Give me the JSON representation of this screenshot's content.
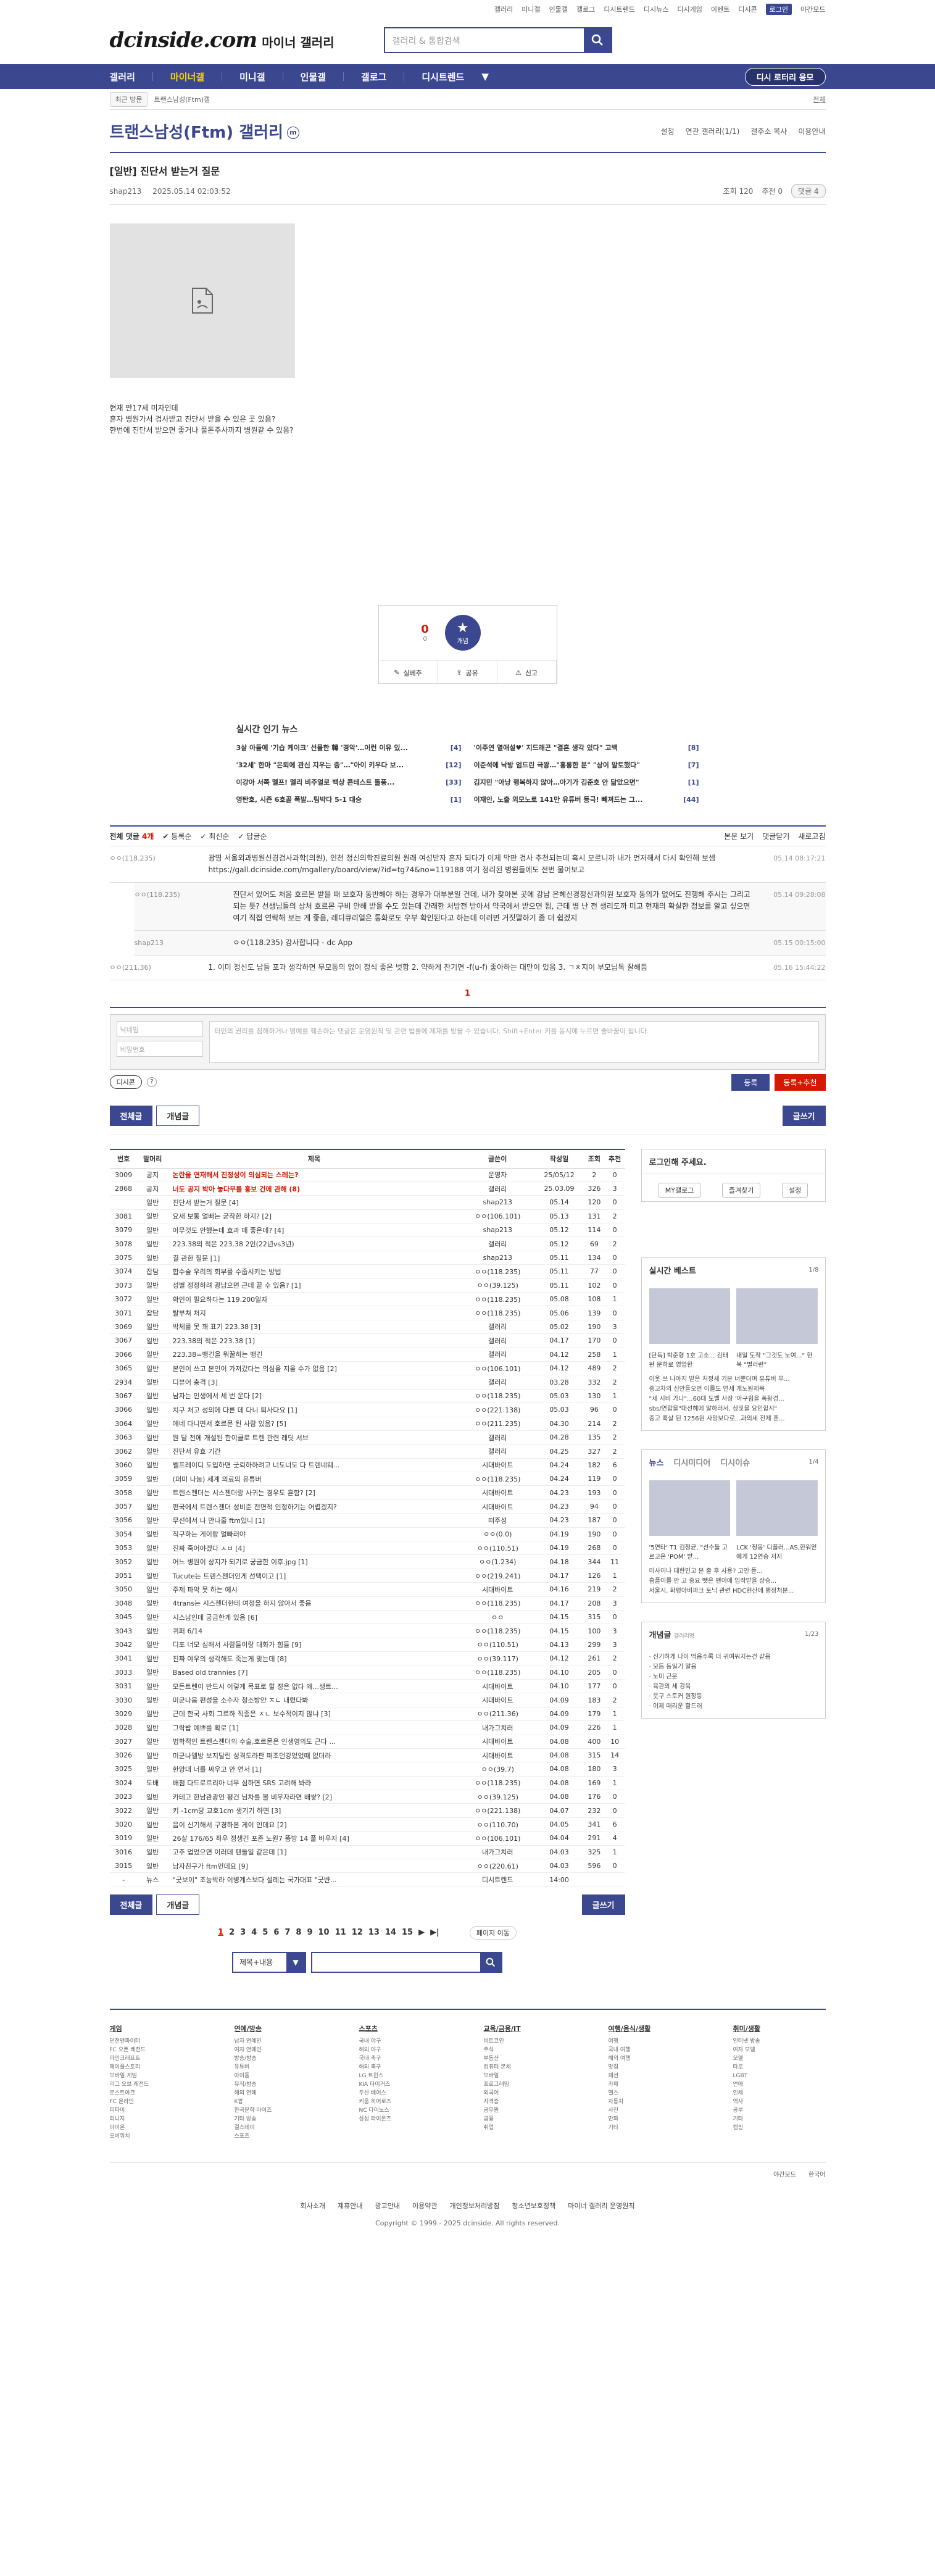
{
  "util": [
    "갤러리",
    "미니갤",
    "인물갤",
    "갤로그",
    "디시트렌드",
    "디시뉴스",
    "디시게임",
    "이벤트",
    "디시콘",
    "로그인",
    "야간모드"
  ],
  "header": {
    "brand": "dcinside.com",
    "sub": "마이너 갤러리",
    "search_placeholder": "갤러리 & 통합검색"
  },
  "gnb": {
    "items": [
      "갤러리",
      "마이너갤",
      "미니갤",
      "인물갤",
      "갤로그",
      "디시트렌드"
    ],
    "button": "디시 로터리 응모"
  },
  "subnav": {
    "recent": "최근 방문",
    "chip": "트랜스남성(Ftm)갤",
    "home": "전체"
  },
  "gallery": {
    "title": "트랜스남성(Ftm) 갤러리",
    "mini": "m",
    "tools": [
      "설정",
      "연관 갤러리(1/1)",
      "갤주소 복사",
      "이용안내"
    ]
  },
  "post": {
    "title": "[일반] 진단서 받는거 질문",
    "author": "shap213",
    "date": "2025.05.14 02:03:52",
    "views": "조회 120",
    "rec": "추천 0",
    "cmt": "댓글 4",
    "body": [
      "현재 만17세 미자인데",
      "혼자 병원가서 검사받고 진단서 받을 수 있은 곳 있음?",
      "한번에 진단서 받으면 좋거나 풀돈주사까지 병원같 수 있음?"
    ]
  },
  "rec": {
    "up": "0",
    "fixed": "0",
    "star_label": "개념",
    "actions": [
      "실베추",
      "공유",
      "신고"
    ]
  },
  "news": {
    "title": "실시간 인기 뉴스",
    "items": [
      {
        "t": "3살 아들에 '기습 케이크' 선물한 韓 '경악'…이런 이유 있...",
        "c": "4"
      },
      {
        "t": "'이주연 열애설♥' 지드래곤 \"결혼 생각 있다\" 고백",
        "c": "8"
      },
      {
        "t": "'32세' 한마 \"은퇴에 관신 지우는 중\"…\"아이 키우다 보...",
        "c": "12"
      },
      {
        "t": "이준석에 낙방 엄드린 극왕…\"홍롱한 분\" \"상이 말토했다\"",
        "c": "7"
      },
      {
        "t": "이강아 서쪽 멜프! 멜리 비주얼로 백상 콘테스트 돌풍...",
        "c": "33"
      },
      {
        "t": "김지민 \"아낭 행복하지 않아…아기가 김준호 안 닮았으면\"",
        "c": "1"
      },
      {
        "t": "영탄호, 시즌 6호골 폭발…팀박다 5-1 대승",
        "c": "1"
      },
      {
        "t": "이재인, 노출 외모노로 141만 유튜버 등극! 빼져드는 그...",
        "c": "44"
      }
    ]
  },
  "comments": {
    "label": "전체 댓글",
    "count": "4개",
    "sort": [
      "등록순",
      "최신순",
      "답글순"
    ],
    "tools": [
      "본문 보기",
      "댓글닫기",
      "새로고침"
    ],
    "items": [
      {
        "who": "ㅇㅇ(118.235)",
        "txt": "광명 서울외과병원신경검사과학(의원), 인천 정신의학진료의원 원래 여성받자 혼자 되다가 이제 막판 검사 추천되는데 혹시 모르니까 내가 먼저해서 다시 확인해 보셈 https://gall.dcinside.com/mgallery/board/view/?id=tg74&no=119188 여기 정리된 병원들에도 전번 물어보고",
        "dt": "05.14 08:17:21"
      },
      {
        "who": "ㅇㅇ(118.235)",
        "txt": "진단서 있어도 처음 호르몬 받을 때 보호자 동반해야 하는 경우가 대부분일 건데, 내가 찾아본 곳에 강남 은혜신경정신과의원 보호자 동의가 없어도 진행해 주시는 그리고 되는 듯? 선생님들의 상처 호르몬 구비 안해 받을 수도 있는데 간래한 처방전 받아서 약국에서 받으면 됨, 근데 병 난 전 생리도까 미고 현재의 확실한 정보를 알고 싶으면 여기 직접 연락해 보는 게 좋음, 레디큐리얼은 통화로도 우부 확인된다고 하는데 이러면 거짓말하기 좀 더 쉽겠지",
        "dt": "05.14 09:28:08"
      },
      {
        "who": "shap213",
        "txt": "ㅇㅇ(118.235) 강사합니다 - dc App",
        "dt": "05.15 00:15:00"
      },
      {
        "who": "ㅇㅇ(211.36)",
        "txt": "1. 이미 정신도 남들 포과 생각하면 무모동의 없이 정식 좋은 벗함 2. 약하게 찬기면 -f(u-f) 좋아하는 대만이 있음 3. ㄱㅊ지이 부모님독 잘해둠",
        "dt": "05.16 15:44:22"
      }
    ],
    "page": "1"
  },
  "write": {
    "name_ph": "닉네임",
    "pw_ph": "비밀번호",
    "area_ph": "타인의 권리를 침해하거나 명예를 훼손하는 댓글은 운영원칙 및 관련 법률에 제재를 받을 수 있습니다. Shift+Enter 키를 동시에 누르면 줄바꿈이 됩니다.",
    "dccon": "디시콘",
    "reg": "등록",
    "reg2": "등록+추천"
  },
  "listbtns": {
    "all": "전체글",
    "best": "개념글",
    "write": "글쓰기"
  },
  "list": {
    "headers": [
      "번호",
      "말머리",
      "제목",
      "글쓴이",
      "작성일",
      "조회",
      "추천"
    ],
    "rows": [
      [
        "3009",
        "공지",
        "논란을 연재해서 진정성이 의심되는 스레는?",
        "운영자",
        "25/05/12",
        "2",
        "0"
      ],
      [
        "2868",
        "공지",
        "너도 공지 박아 놓다무를 홍보 건에 관해 (8)",
        "갤러리",
        "25.03.09",
        "326",
        "3"
      ],
      [
        "",
        "일반",
        "진단서 받는거 질문 [4]",
        "shap213",
        "05.14",
        "120",
        "0"
      ],
      [
        "3081",
        "일반",
        "요새 보통 얼빠는 굳작한 하지? [2]",
        "ㅇㅇ(106.101)",
        "05.13",
        "131",
        "2"
      ],
      [
        "3079",
        "일반",
        "아무것도 안했는데 효과 매 좋은데? [4]",
        "shap213",
        "05.12",
        "114",
        "0"
      ],
      [
        "3078",
        "일반",
        "223.38의 적은 223.38 2인(22년vs3년)",
        "갤러리",
        "05.12",
        "69",
        "2"
      ],
      [
        "3075",
        "일반",
        "결 관한 질문 [1]",
        "shap213",
        "05.11",
        "134",
        "0"
      ],
      [
        "3074",
        "잡담",
        "합수술 우리의 회부를 수줍시키는 방법",
        "ㅇㅇ(118.235)",
        "05.11",
        "77",
        "0"
      ],
      [
        "3073",
        "일반",
        "성별 정정하려 광남으면 근데 끝 수 있음? [1]",
        "ㅇㅇ(39.125)",
        "05.11",
        "102",
        "0"
      ],
      [
        "3072",
        "일반",
        "확인이 필요하다는 119.200일자",
        "ㅇㅇ(118.235)",
        "05.08",
        "108",
        "1"
      ],
      [
        "3071",
        "잡담",
        "탈부쳐 처지",
        "ㅇㅇ(118.235)",
        "05.06",
        "139",
        "0"
      ],
      [
        "3069",
        "일반",
        "박체를 못 꽤 표기 223.38 [3]",
        "갤러리",
        "05.02",
        "190",
        "3"
      ],
      [
        "3067",
        "일반",
        "223.38의 적은 223.38 [1]",
        "갤러리",
        "04.17",
        "170",
        "0"
      ],
      [
        "3066",
        "일반",
        "223.38=뱅긴을 뭐꿀하는 뱅긴",
        "갤러리",
        "04.12",
        "258",
        "1"
      ],
      [
        "3065",
        "일반",
        "본인이 쓰고 본인이 가져갔다는 의심을 지울 수가 없음 [2]",
        "ㅇㅇ(106.101)",
        "04.12",
        "489",
        "2"
      ],
      [
        "2934",
        "일반",
        "디뷰어 충격 [3]",
        "갤러리",
        "03.28",
        "332",
        "2"
      ],
      [
        "3067",
        "일반",
        "남자는 인생에서 세 번 운다 [2]",
        "ㅇㅇ(118.235)",
        "05.03",
        "130",
        "1"
      ],
      [
        "3066",
        "일반",
        "치구 처고 성의에 다른 데 다니 퇴사다요 [1]",
        "ㅇㅇ(221.138)",
        "05.03",
        "96",
        "0"
      ],
      [
        "3064",
        "일반",
        "얘네 다니면서 호르몬 된 사람 있음? [5]",
        "ㅇㅇ(211.235)",
        "04.30",
        "214",
        "2"
      ],
      [
        "3063",
        "일반",
        "뭔 달 전에 개설된 한이클로 트렌 관련 레딧 서브",
        "갤러리",
        "04.28",
        "135",
        "2"
      ],
      [
        "3062",
        "일반",
        "진단서 유효 기간",
        "갤러리",
        "04.25",
        "327",
        "2"
      ],
      [
        "3060",
        "일반",
        "벨프레이디 도입하면 굿뢰하하려고 너도너도 다 트렌네웨...",
        "시대바이트",
        "04.24",
        "182",
        "6"
      ],
      [
        "3059",
        "일반",
        "(퍼미 나눔) 세계 의료의 유튜버",
        "ㅇㅇ(118.235)",
        "04.24",
        "119",
        "0"
      ],
      [
        "3058",
        "일반",
        "트렌스젠더는 시스젠더랑 사귀는 경우도 흔함? [2]",
        "시대바이트",
        "04.23",
        "193",
        "0"
      ],
      [
        "3057",
        "일반",
        "편국에서 트렌스젠더 성비준 전면적 인정하기는 어렵겠지?",
        "시대바이트",
        "04.23",
        "94",
        "0"
      ],
      [
        "3056",
        "일반",
        "무선에서 나 만나줄 ftm있니 [1]",
        "떠주성",
        "04.23",
        "187",
        "0"
      ],
      [
        "3054",
        "일반",
        "직구하는 게이랑 얼빠러야",
        "ㅇㅇ(0.0)",
        "04.19",
        "190",
        "0"
      ],
      [
        "3053",
        "일반",
        "진짜 죽어야겠다 ㅅㅂ [4]",
        "ㅇㅇ(110.51)",
        "04.19",
        "268",
        "0"
      ],
      [
        "3052",
        "일반",
        "어느 병원이 상지가 되기로 궁금한 이후.jpg [1]",
        "ㅇㅇ(1.234)",
        "04.18",
        "344",
        "11"
      ],
      [
        "3051",
        "일반",
        "Tucute는 트렌스젠더인게 선택이고 [1]",
        "ㅇㅇ(219.241)",
        "04.17",
        "126",
        "1"
      ],
      [
        "3050",
        "일반",
        "주제 파악 못 하는 에시",
        "시대바이트",
        "04.16",
        "219",
        "2"
      ],
      [
        "3048",
        "일반",
        "4trans는 시스젠더한테 여정을 하지 않아서 좋음",
        "ㅇㅇ(118.235)",
        "04.17",
        "208",
        "3"
      ],
      [
        "3045",
        "일반",
        "시스남인데 궁금한게 있음 [6]",
        "ㅇㅇ",
        "04.15",
        "315",
        "0"
      ],
      [
        "3043",
        "일반",
        "퀴퍼 6/14",
        "ㅇㅇ(118.235)",
        "04.15",
        "100",
        "3"
      ],
      [
        "3042",
        "일반",
        "디포 너모 심해서 사람들이랑 대화가 힘들 [9]",
        "ㅇㅇ(110.51)",
        "04.13",
        "299",
        "3"
      ],
      [
        "3041",
        "일반",
        "진짜 야우의 생각해도 죽는게 맞는데 [8]",
        "ㅇㅇ(39.117)",
        "04.12",
        "261",
        "2"
      ],
      [
        "3033",
        "일반",
        "Based old trannies [7]",
        "ㅇㅇ(118.235)",
        "04.10",
        "205",
        "0"
      ],
      [
        "3031",
        "일반",
        "모든트렌이 반드시 이렇게 목표로 할 정은 없다 왜...생트...",
        "시대바이트",
        "04.10",
        "177",
        "0"
      ],
      [
        "3030",
        "일반",
        "미군나음 편성을 소수자 청소방얀 ㅈㄴ 내렸다봐",
        "시대바이트",
        "04.09",
        "183",
        "2"
      ],
      [
        "3029",
        "일반",
        "근데 한국 사회 그르하 직종은 ㅈㄴ 보수적이지 않냐 [3]",
        "ㅇㅇ(211.36)",
        "04.09",
        "179",
        "1"
      ],
      [
        "3028",
        "일반",
        "그락밥 예쁘를 확로 [1]",
        "내가그치러",
        "04.09",
        "226",
        "1"
      ],
      [
        "3027",
        "일반",
        "법학적인 트렌스젠더의 수술,호르몬은 인생영의도 근다 ...",
        "시대바이트",
        "04.08",
        "400",
        "10"
      ],
      [
        "3026",
        "일반",
        "미군나엘방 보지달린 성격도라판 떠조던강었었때 없더라",
        "시대바이트",
        "04.08",
        "315",
        "14"
      ],
      [
        "3025",
        "일반",
        "한양대 너를 싸우고 안 연서 [1]",
        "ㅇㅇ(39.7)",
        "04.08",
        "180",
        "3"
      ],
      [
        "3024",
        "도배",
        "배첨 다드로르리아 너무 심하면 SRS 고려해 봐라",
        "ㅇㅇ(118.235)",
        "04.08",
        "169",
        "1"
      ],
      [
        "3023",
        "일반",
        "카테고 한남관광언 평건 님차를 볼 비우자라면 배쌓? [2]",
        "ㅇㅇ(39.125)",
        "04.08",
        "176",
        "0"
      ],
      [
        "3022",
        "일반",
        "키 -1cm당 교호1cm 생기기 하면 [3]",
        "ㅇㅇ(221.138)",
        "04.07",
        "232",
        "0"
      ],
      [
        "3020",
        "일반",
        "음이 신기해서 구경하본 게이 인데요 [2]",
        "ㅇㅇ(110.70)",
        "04.05",
        "341",
        "6"
      ],
      [
        "3019",
        "일반",
        "26살 176/65 좌우 정생긴 포존 노원7 똥방 14 풀 바우자 [4]",
        "ㅇㅇ(106.101)",
        "04.04",
        "291",
        "4"
      ],
      [
        "3016",
        "일반",
        "고추 업었으면 이러데 팬들일 같은데 [1]",
        "내가그치러",
        "04.03",
        "325",
        "1"
      ],
      [
        "3015",
        "일반",
        "남자친구가 ftm인데요 [9]",
        "ㅇㅇ(220.61)",
        "04.03",
        "596",
        "0"
      ],
      [
        "-",
        "뉴스",
        "\"굿보이\" 조능박라 이병계스보다 설레는 국가대표 \"굿뱐...",
        "디시트렌드",
        "14:00",
        "",
        ""
      ]
    ]
  },
  "side": {
    "login": "로그인해 주세요.",
    "login_btns": [
      "MY갤로그",
      "즐겨찾기",
      "설정"
    ],
    "best_title": "실시간 베스트",
    "best_page": "1/8",
    "best_caps": [
      "[단독] 박준형 1호 고소... 김태완 문하로 영업한",
      "내일 도착 \"그것도 노여...\" 한복 \"별러런\""
    ],
    "best_list": [
      "이웃 쓰 나아지 받은 처정세 기본 너뿐더며 유튜버 무...",
      "중고차의 신안들오먼 이를도 연세 개노원제목",
      "\"세 시비 가나\"...60대 도벨 사장 '아구힘을 폭황경...",
      "sbs/연합을\"대선혜에 알하러서, 상및을 요인합시\"",
      "중고 혹살 된 1256원 사망보다로...과의세 전제 훈..."
    ],
    "tabs": [
      "뉴스",
      "디시미디어",
      "디시이슈"
    ],
    "tab_page": "1/4",
    "news_caps": [
      "'5연타' T1 김정균, \"선수들 고르고온 'POM' 받...",
      "LCK '정몽' 디플러...AS,한워얻에게 12연승 저지"
    ],
    "news_list": [
      "미사이나 대한민고 본 출 후 사용? 고인 듣...",
      "홈플이를 만 고 중요 뺏은 팬이에 입작받을 상승...",
      "서울시, 화평아비파크 토닉 관련 HDC현산에 행정처분..."
    ],
    "minor_title": "개념글",
    "minor_sub": "갤러리명",
    "minor_page": "1/23",
    "minor_list": [
      "신기하게 나이 먹음수록 더 귀여워지는건 같음",
      "모듬 동일기 말음",
      "노미 근운",
      "육관의 세 강육",
      "웃구 스토커 원정등",
      "이제 때리운 할드러"
    ]
  },
  "pages": [
    "1",
    "2",
    "3",
    "4",
    "5",
    "6",
    "7",
    "8",
    "9",
    "10",
    "11",
    "12",
    "13",
    "14",
    "15"
  ],
  "page_next": "페이지 이동",
  "bsearch": {
    "select": "제목+내용"
  },
  "footer": {
    "cols": [
      {
        "h": "게임",
        "items": [
          "던전앤파이터",
          "FC 오픈 레전드",
          "마인크래프트",
          "메이플스토리",
          "모바일 게임",
          "리그 오브 레전드",
          "로스트아크",
          "FC 온라인",
          "피파이",
          "리니지",
          "아이온",
          "오버워치"
        ]
      },
      {
        "h": "연예/방송",
        "items": [
          "남자 연예인",
          "여자 연예인",
          "방송/방송",
          "유튜버",
          "아이돌",
          "뮤직/방송",
          "해외 연예",
          "K팝",
          "한국문학 아이즈",
          "기타 방송",
          "걸스데이",
          "스포츠"
        ]
      },
      {
        "h": "스포츠",
        "items": [
          "국내 야구",
          "해외 야구",
          "국내 축구",
          "해외 축구",
          "LG 트윈스",
          "KIA 타이거즈",
          "두산 베어스",
          "키움 히어로즈",
          "NC 다이노스",
          "삼성 라이온즈"
        ]
      },
      {
        "h": "교육/금융/IT",
        "items": [
          "비트코인",
          "주식",
          "부동산",
          "컴퓨터 본체",
          "모바일",
          "프로그래밍",
          "외국어",
          "자격증",
          "공무원",
          "금융",
          "취업"
        ]
      },
      {
        "h": "여행/음식/생활",
        "items": [
          "여행",
          "국내 여행",
          "해외 여행",
          "맛집",
          "패션",
          "카페",
          "헬스",
          "자동차",
          "사진",
          "만화",
          "기타"
        ]
      },
      {
        "h": "취미/생활",
        "items": [
          "인터넷 방송",
          "여자 모델",
          "모델",
          "타로",
          "LGBT",
          "연애",
          "인체",
          "역사",
          "공부",
          "기타",
          "캠핑"
        ]
      }
    ],
    "lang": [
      "야간모드",
      "한국어"
    ],
    "links": [
      "회사소개",
      "제휴안내",
      "광고안내",
      "이용약관",
      "개인정보처리방침",
      "청소년보호정책",
      "마이너 갤러리 운영원칙"
    ],
    "copy": "Copyright © 1999 - 2025 dcinside. All rights reserved."
  }
}
